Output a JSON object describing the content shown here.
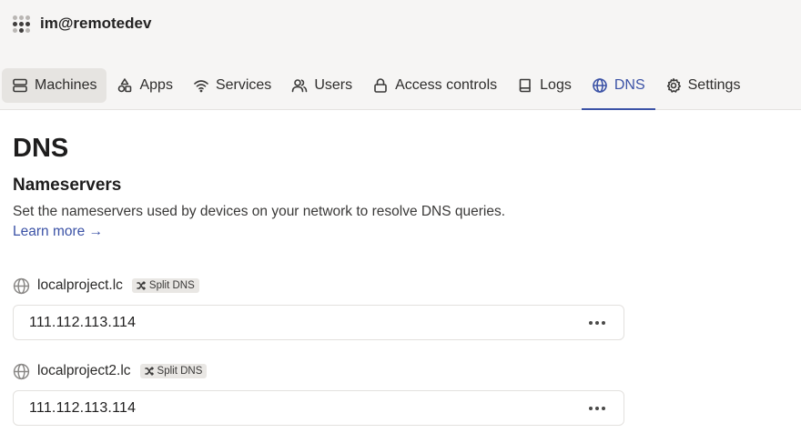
{
  "tailnet": {
    "name": "im@remotedev"
  },
  "nav": {
    "tabs": [
      {
        "label": "Machines",
        "icon": "machines-icon"
      },
      {
        "label": "Apps",
        "icon": "apps-icon"
      },
      {
        "label": "Services",
        "icon": "wifi-icon"
      },
      {
        "label": "Users",
        "icon": "users-icon"
      },
      {
        "label": "Access controls",
        "icon": "lock-icon"
      },
      {
        "label": "Logs",
        "icon": "book-icon"
      },
      {
        "label": "DNS",
        "icon": "globe-icon"
      },
      {
        "label": "Settings",
        "icon": "gear-icon"
      }
    ],
    "selected": "DNS",
    "accent": "#3b52a6"
  },
  "page": {
    "title": "DNS",
    "section_title": "Nameservers",
    "description": "Set the nameservers used by devices on your network to resolve DNS queries.",
    "learn_more": "Learn more →"
  },
  "nameservers": [
    {
      "domain": "localproject.lc",
      "badge": "Split DNS",
      "ip": "111.112.113.114"
    },
    {
      "domain": "localproject2.lc",
      "badge": "Split DNS",
      "ip": "111.112.113.114"
    }
  ]
}
